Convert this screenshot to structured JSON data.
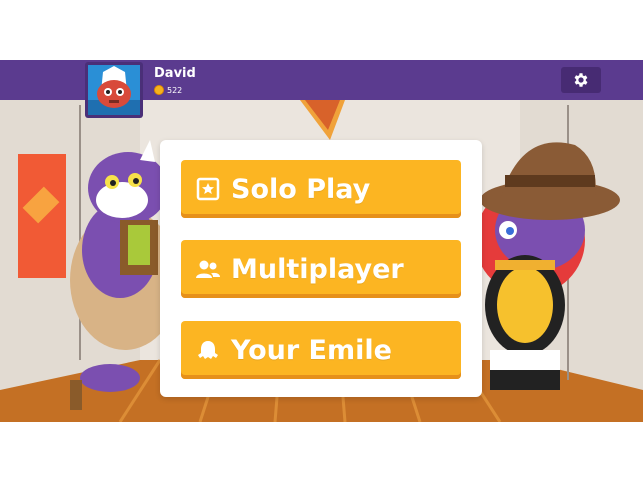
{
  "header": {
    "username": "David",
    "coins": "522",
    "settings_icon": "gear-icon"
  },
  "menu": {
    "solo_label": "Solo Play",
    "multi_label": "Multiplayer",
    "emile_label": "Your Emile"
  },
  "colors": {
    "header_bg": "#5b3b8f",
    "button_bg": "#fcb522",
    "button_text": "#ffffff"
  }
}
